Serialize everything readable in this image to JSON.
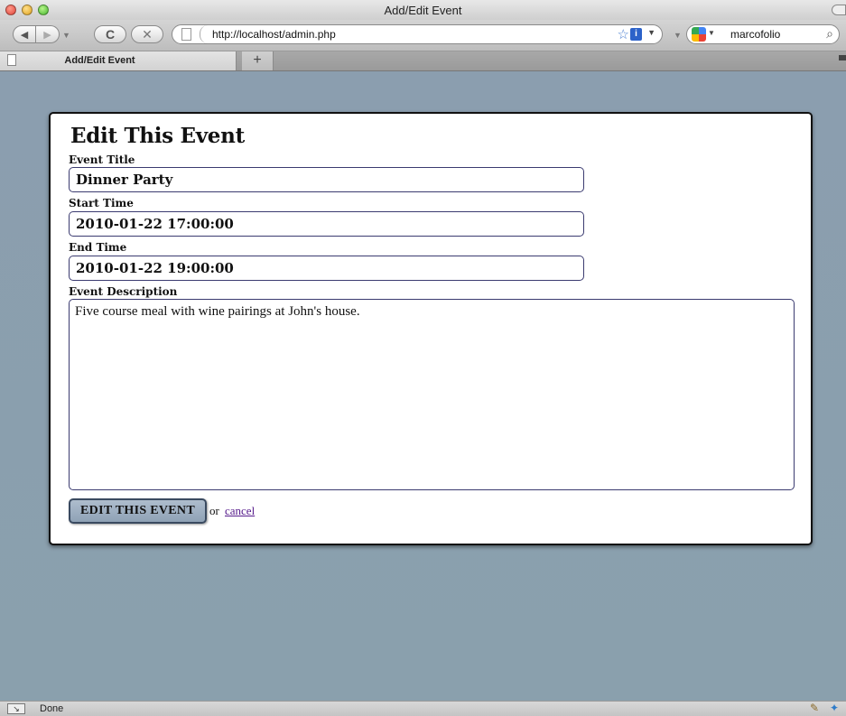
{
  "window": {
    "title": "Add/Edit Event"
  },
  "toolbar": {
    "back_glyph": "◀",
    "forward_glyph": "▶",
    "reload_glyph": "C",
    "stop_glyph": "✕",
    "url": "http://localhost/admin.php",
    "search_value": "marcofolio"
  },
  "tabs": [
    {
      "label": "Add/Edit Event",
      "active": true
    }
  ],
  "new_tab_glyph": "+",
  "form": {
    "heading": "Edit This Event",
    "fields": {
      "title_label": "Event Title",
      "title_value": "Dinner Party",
      "start_label": "Start Time",
      "start_value": "2010-01-22 17:00:00",
      "end_label": "End Time",
      "end_value": "2010-01-22 19:00:00",
      "desc_label": "Event Description",
      "desc_value": "Five course meal with wine pairings at John's house."
    },
    "submit_label": "EDIT THIS EVENT",
    "or_text": "or",
    "cancel_label": "cancel"
  },
  "status": {
    "text": "Done"
  },
  "colors": {
    "page_bg": "#8e9faf",
    "card_border": "#111111",
    "button_bg": "#9fb0c2",
    "link_visited": "#551a8b"
  }
}
